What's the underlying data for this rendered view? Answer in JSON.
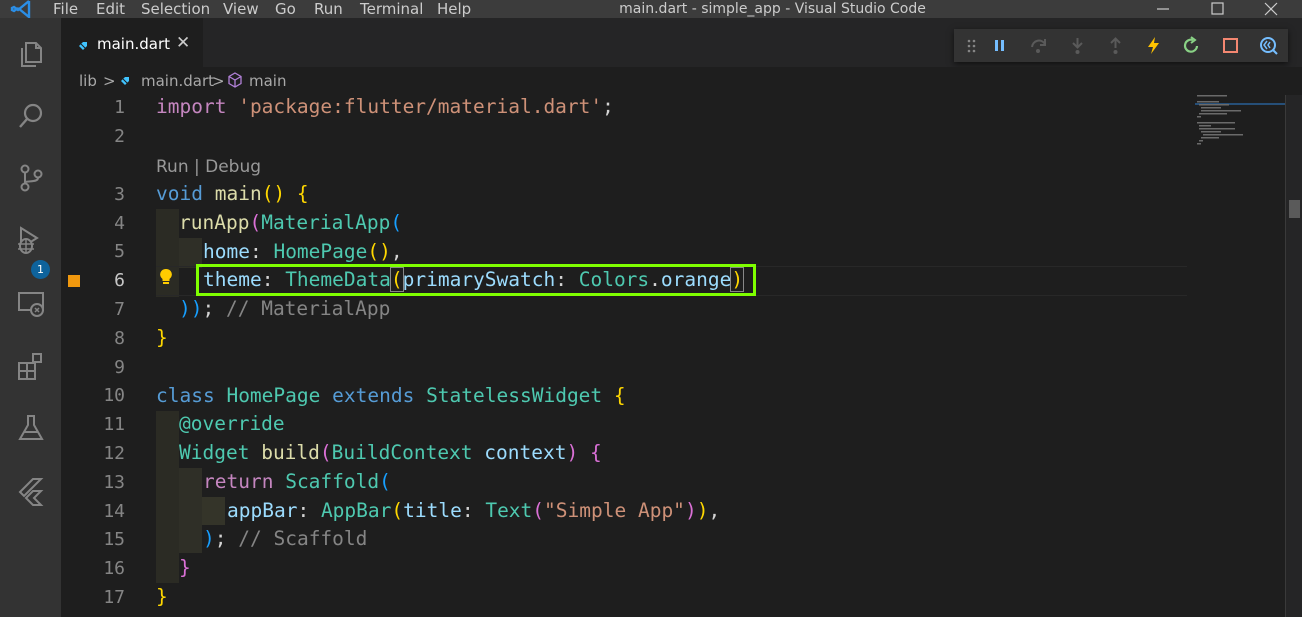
{
  "window": {
    "title": "main.dart - simple_app - Visual Studio Code",
    "menu": [
      "File",
      "Edit",
      "Selection",
      "View",
      "Go",
      "Run",
      "Terminal",
      "Help"
    ]
  },
  "colors": {
    "accent_blue": "#0e639c",
    "highlight_box": "#7fff00",
    "breakpoint": "#f0980e"
  },
  "activity_bar": {
    "items": [
      "explorer-icon",
      "search-icon",
      "source-control-icon",
      "run-debug-icon",
      "remote-explorer-icon",
      "extensions-icon",
      "testing-icon",
      "flutter-icon"
    ],
    "debug_badge": "1"
  },
  "tab": {
    "label": "main.dart",
    "close": "✕"
  },
  "breadcrumb": {
    "folder": "lib",
    "sep1": ">",
    "file": "main.dart",
    "sep2": ">",
    "symbol": "main"
  },
  "debug_toolbar": [
    "drag-handle-icon",
    "pause-icon",
    "step-over-icon",
    "step-into-icon",
    "step-out-icon",
    "hot-reload-icon",
    "hot-restart-icon",
    "stop-icon",
    "devtools-icon"
  ],
  "editor": {
    "codelens": "Run | Debug",
    "line_numbers": [
      "1",
      "2",
      "3",
      "4",
      "5",
      "6",
      "7",
      "8",
      "9",
      "10",
      "11",
      "12",
      "13",
      "14",
      "15",
      "16",
      "17"
    ],
    "active_line": "6",
    "lines": {
      "l1": [
        "import",
        " ",
        "'package:flutter/material.dart'",
        ";"
      ],
      "l3": [
        "void",
        " ",
        "main",
        "()",
        " ",
        "{"
      ],
      "l4": [
        "runApp",
        "(",
        "MaterialApp",
        "("
      ],
      "l5": [
        "home",
        ": ",
        "HomePage",
        "()",
        ","
      ],
      "l6": [
        "theme",
        ": ",
        "ThemeData",
        "(",
        "primarySwatch",
        ": ",
        "Colors",
        ".",
        "orange",
        ")"
      ],
      "l7": [
        "))",
        ";",
        " ",
        "// MaterialApp"
      ],
      "l8": [
        "}"
      ],
      "l10": [
        "class",
        " ",
        "HomePage",
        " ",
        "extends",
        " ",
        "StatelessWidget",
        " ",
        "{"
      ],
      "l11": [
        "@override"
      ],
      "l12": [
        "Widget",
        " ",
        "build",
        "(",
        "BuildContext",
        " ",
        "context",
        ")",
        " ",
        "{"
      ],
      "l13": [
        "return",
        " ",
        "Scaffold",
        "("
      ],
      "l14": [
        "appBar",
        ": ",
        "AppBar",
        "(",
        "title",
        ": ",
        "Text",
        "(",
        "\"Simple App\"",
        ")",
        ")",
        ","
      ],
      "l15": [
        ")",
        ";",
        " ",
        "// Scaffold"
      ],
      "l16": [
        "}"
      ],
      "l17": [
        "}"
      ]
    }
  }
}
